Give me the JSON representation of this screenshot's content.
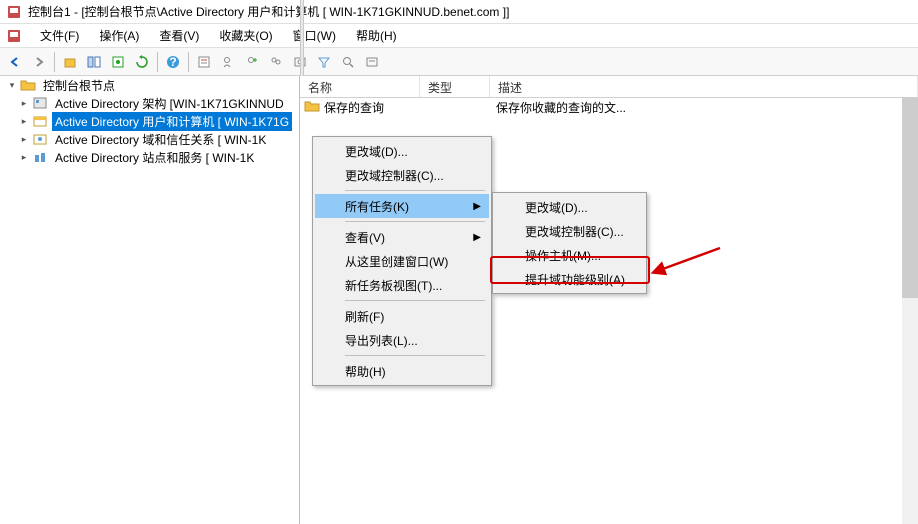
{
  "titlebar": {
    "text": "控制台1 - [控制台根节点\\Active Directory 用户和计算机 [ WIN-1K71GKINNUD.benet.com ]]"
  },
  "menubar": {
    "file": "文件(F)",
    "action": "操作(A)",
    "view": "查看(V)",
    "favorites": "收藏夹(O)",
    "window": "窗口(W)",
    "help": "帮助(H)"
  },
  "tree": {
    "root": "控制台根节点",
    "items": [
      "Active Directory 架构 [WIN-1K71GKINNUD",
      "Active Directory 用户和计算机 [ WIN-1K71G",
      "Active Directory 域和信任关系 [ WIN-1K",
      "Active Directory 站点和服务 [ WIN-1K"
    ]
  },
  "list": {
    "columns": {
      "name": "名称",
      "type": "类型",
      "desc": "描述"
    },
    "rows": [
      {
        "name": "保存的查询",
        "type": "",
        "desc": "保存你收藏的查询的文..."
      }
    ]
  },
  "context_menu_1": {
    "change_domain": "更改域(D)...",
    "change_dc": "更改域控制器(C)...",
    "all_tasks": "所有任务(K)",
    "view": "查看(V)",
    "new_window": "从这里创建窗口(W)",
    "new_taskpad": "新任务板视图(T)...",
    "refresh": "刷新(F)",
    "export": "导出列表(L)...",
    "help": "帮助(H)"
  },
  "context_menu_2": {
    "change_domain": "更改域(D)...",
    "change_dc": "更改域控制器(C)...",
    "op_master": "操作主机(M)...",
    "raise_dfl": "提升域功能级别(A)..."
  }
}
